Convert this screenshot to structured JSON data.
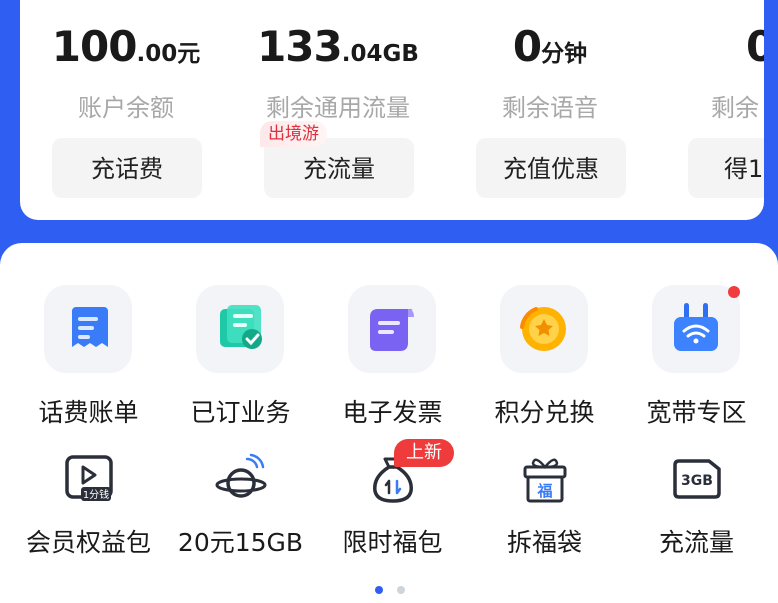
{
  "account": {
    "balance": {
      "main": "100",
      "decimal": ".00",
      "unit": "元",
      "label": "账户余额",
      "button": "充话费"
    },
    "data": {
      "main": "133",
      "decimal": ".04",
      "unit": "GB",
      "label": "剩余通用流量",
      "button": "充流量",
      "tag": "出境游"
    },
    "voice": {
      "main": "0",
      "unit": "分钟",
      "label": "剩余语音",
      "button": "充值优惠"
    },
    "fourth": {
      "main": "0",
      "label": "剩余",
      "button": "得1"
    }
  },
  "services_row1": [
    {
      "label": "话费账单",
      "icon": "bill-icon"
    },
    {
      "label": "已订业务",
      "icon": "subscribed-icon"
    },
    {
      "label": "电子发票",
      "icon": "invoice-icon"
    },
    {
      "label": "积分兑换",
      "icon": "points-icon"
    },
    {
      "label": "宽带专区",
      "icon": "broadband-router-icon"
    }
  ],
  "services_row2": [
    {
      "label": "会员权益包",
      "icon": "video-member-icon",
      "icon_text": "1分钱"
    },
    {
      "label": "20元15GB",
      "icon": "planet-icon"
    },
    {
      "label": "限时福包",
      "icon": "money-bag-icon",
      "badge": "上新"
    },
    {
      "label": "拆福袋",
      "icon": "gift-box-icon",
      "icon_text": "福"
    },
    {
      "label": "充流量",
      "icon": "sim-card-icon",
      "icon_text": "3GB"
    }
  ],
  "colors": {
    "brand_blue": "#2f5ff2",
    "alert_red": "#ef3b3b"
  }
}
